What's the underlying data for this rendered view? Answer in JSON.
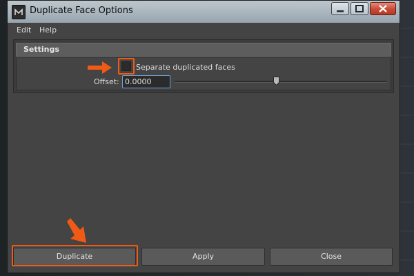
{
  "window": {
    "title": "Duplicate Face Options"
  },
  "menu": {
    "items": [
      "Edit",
      "Help"
    ]
  },
  "settings": {
    "header": "Settings",
    "separate_label": "Separate duplicated faces",
    "separate_checked": false,
    "offset_label": "Offset:",
    "offset_value": "0.0000",
    "slider_fraction": 0.48
  },
  "buttons": {
    "duplicate": "Duplicate",
    "apply": "Apply",
    "close": "Close"
  },
  "colors": {
    "annotation": "#f05a14",
    "focus_border": "#6aa0d8"
  },
  "icons": {
    "app": "maya-app-icon",
    "minimize": "minimize-icon",
    "maximize": "maximize-icon",
    "close": "close-icon",
    "pointer_right": "arrow-right-icon",
    "pointer_down": "arrow-down-right-icon"
  }
}
